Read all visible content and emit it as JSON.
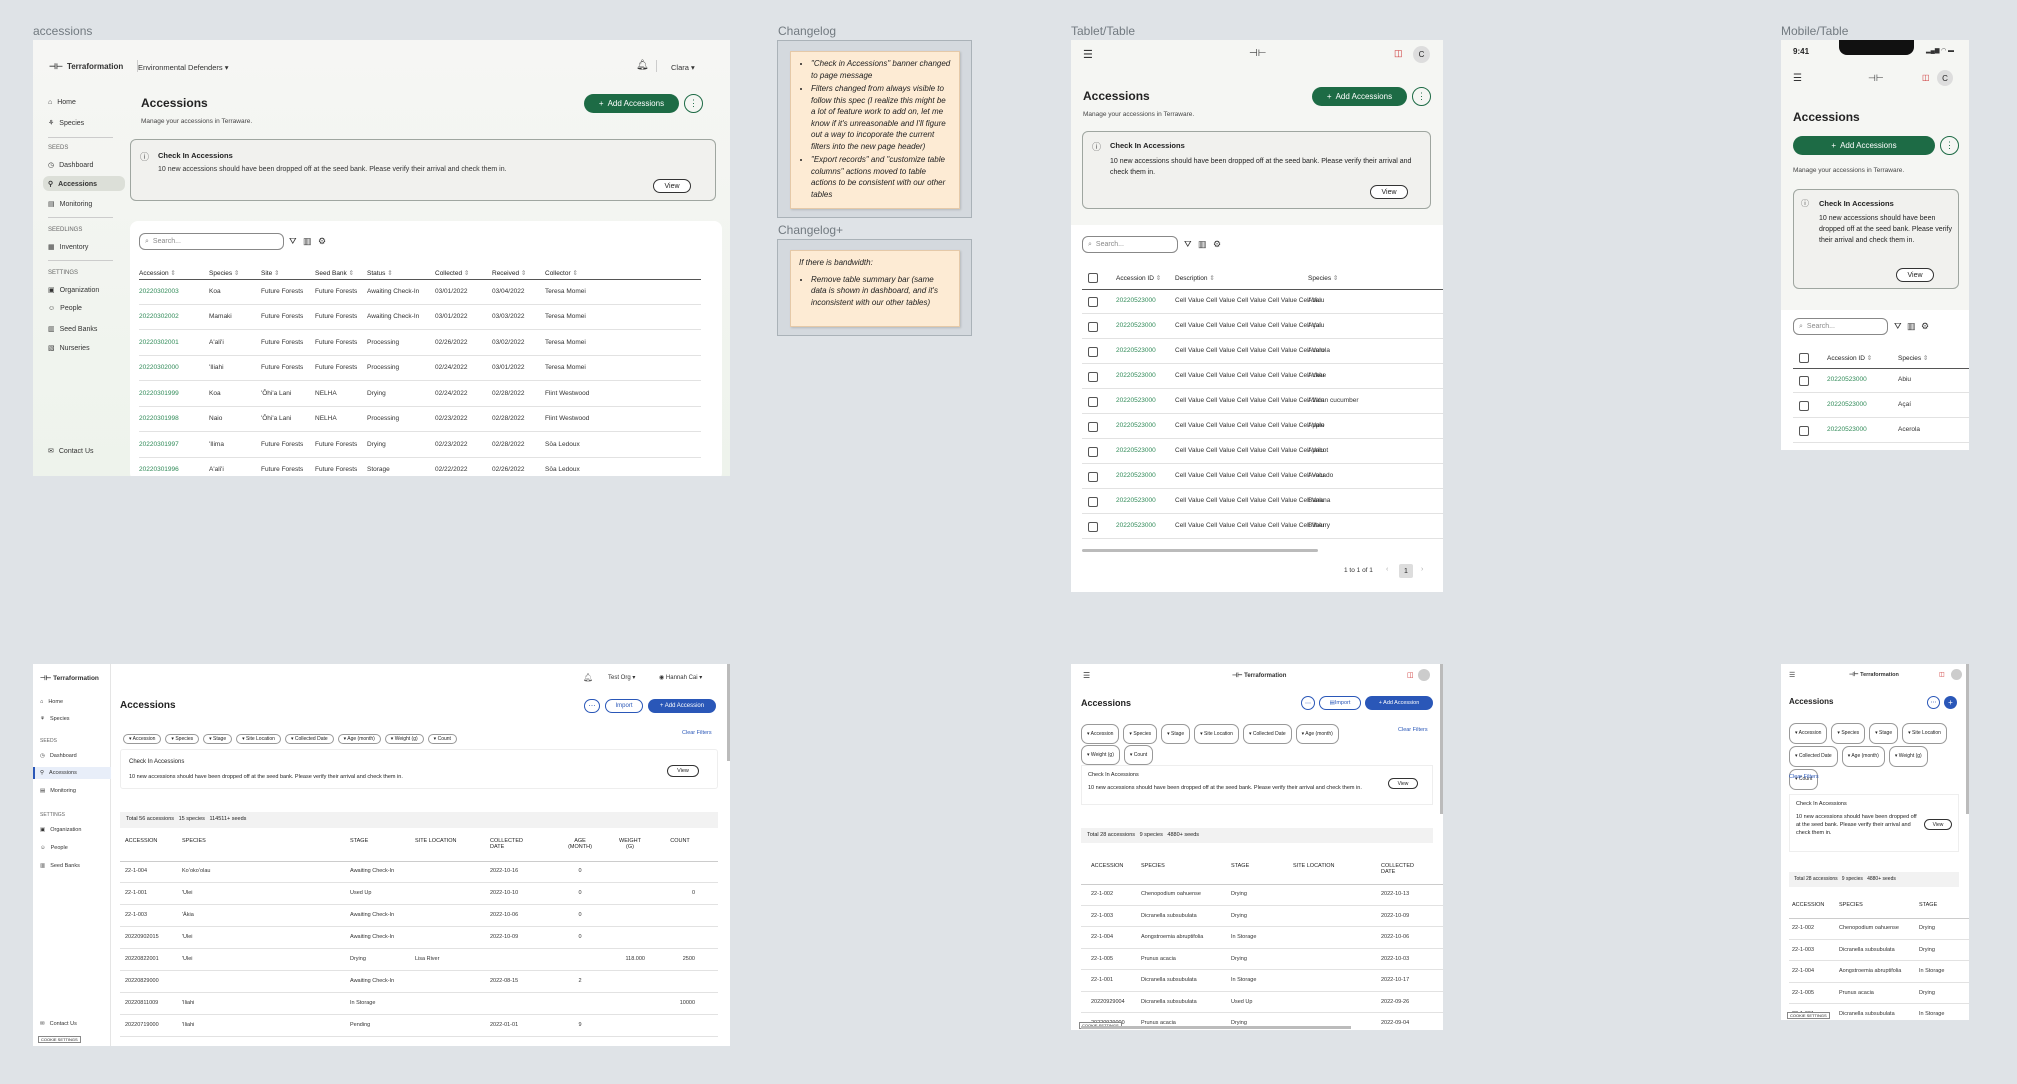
{
  "frame_labels": {
    "accessions": "accessions",
    "changelog": "Changelog",
    "changelog_plus": "Changelog+",
    "tablet": "Tablet/Table",
    "mobile": "Mobile/Table"
  },
  "changelog": {
    "items": [
      "\"Check in Accessions\" banner changed to page message",
      "Filters changed from always visible to follow this spec (I realize this might be a lot of feature work to add on, let me know if it's unreasonable and I'll figure out a way to incoporate the current filters into the new page header)",
      "\"Export records\" and \"customize table columns\" actions moved to table actions to be consistent with our other tables"
    ]
  },
  "changelog_plus": {
    "heading": "If there is bandwidth:",
    "items": [
      "Remove table summary bar (same data is shown in dashboard, and it's inconsistent with our other tables)"
    ]
  },
  "desktop": {
    "logo": "Terraformation",
    "org": "Environmental Defenders",
    "user": "Clara",
    "nav": {
      "home": "Home",
      "species": "Species",
      "seeds_section": "SEEDS",
      "dashboard": "Dashboard",
      "accessions": "Accessions",
      "monitoring": "Monitoring",
      "seedlings_section": "SEEDLINGS",
      "inventory": "Inventory",
      "settings_section": "SETTINGS",
      "organization": "Organization",
      "people": "People",
      "seed_banks": "Seed Banks",
      "nurseries": "Nurseries",
      "contact": "Contact Us"
    },
    "title": "Accessions",
    "subtitle": "Manage your accessions in Terraware.",
    "add_button": "Add Accessions",
    "notice": {
      "title": "Check In Accessions",
      "body": "10 new accessions should have been dropped off at the seed bank. Please verify their arrival and check them in.",
      "view": "View"
    },
    "search_placeholder": "Search...",
    "columns": [
      "Accession",
      "Species",
      "Site",
      "Seed Bank",
      "Status",
      "Collected",
      "Received",
      "Collector"
    ],
    "rows": [
      [
        "20220302003",
        "Koa",
        "Future Forests",
        "Future Forests",
        "Awaiting Check-In",
        "03/01/2022",
        "03/04/2022",
        "Teresa Momei"
      ],
      [
        "20220302002",
        "Mamaki",
        "Future Forests",
        "Future Forests",
        "Awaiting Check-In",
        "03/01/2022",
        "03/03/2022",
        "Teresa Momei"
      ],
      [
        "20220302001",
        "A'ali'i",
        "Future Forests",
        "Future Forests",
        "Processing",
        "02/26/2022",
        "03/02/2022",
        "Teresa Momei"
      ],
      [
        "20220302000",
        "'Iliahi",
        "Future Forests",
        "Future Forests",
        "Processing",
        "02/24/2022",
        "03/01/2022",
        "Teresa Momei"
      ],
      [
        "20220301999",
        "Koa",
        "'Ōhi'a Lani",
        "NELHA",
        "Drying",
        "02/24/2022",
        "02/28/2022",
        "Flint Westwood"
      ],
      [
        "20220301998",
        "Naio",
        "'Ōhi'a Lani",
        "NELHA",
        "Processing",
        "02/23/2022",
        "02/28/2022",
        "Flint Westwood"
      ],
      [
        "20220301997",
        "'Ilima",
        "Future Forests",
        "Future Forests",
        "Drying",
        "02/23/2022",
        "02/28/2022",
        "Sōa Ledoux"
      ],
      [
        "20220301996",
        "A'ali'i",
        "Future Forests",
        "Future Forests",
        "Storage",
        "02/22/2022",
        "02/26/2022",
        "Sōa Ledoux"
      ]
    ]
  },
  "tablet": {
    "title": "Accessions",
    "subtitle": "Manage your accessions in Terraware.",
    "add_button": "Add Accessions",
    "notice": {
      "title": "Check In Accessions",
      "body": "10 new accessions should have been dropped off at the seed bank. Please verify their arrival and check them in.",
      "view": "View"
    },
    "avatar": "C",
    "search_placeholder": "Search...",
    "columns": [
      "Accession ID",
      "Description",
      "Species"
    ],
    "rows": [
      [
        "20220523000",
        "Cell Value Cell Value Cell Value Cell Value Cell Valu",
        "Abiu"
      ],
      [
        "20220523000",
        "Cell Value Cell Value Cell Value Cell Value Cell Valu",
        "Açaí"
      ],
      [
        "20220523000",
        "Cell Value Cell Value Cell Value Cell Value Cell Valu",
        "Acerola"
      ],
      [
        "20220523000",
        "Cell Value Cell Value Cell Value Cell Value Cell Valu",
        "Ackee"
      ],
      [
        "20220523000",
        "Cell Value Cell Value Cell Value Cell Value Cell Valu",
        "African cucumber"
      ],
      [
        "20220523000",
        "Cell Value Cell Value Cell Value Cell Value Cell Valu",
        "Apple"
      ],
      [
        "20220523000",
        "Cell Value Cell Value Cell Value Cell Value Cell Valu",
        "Apricot"
      ],
      [
        "20220523000",
        "Cell Value Cell Value Cell Value Cell Value Cell Valu",
        "Avocado"
      ],
      [
        "20220523000",
        "Cell Value Cell Value Cell Value Cell Value Cell Valu",
        "Banana"
      ],
      [
        "20220523000",
        "Cell Value Cell Value Cell Value Cell Value Cell Valu",
        "Bilberry"
      ]
    ],
    "pagination": "1 to 1 of 1",
    "page": "1"
  },
  "mobile": {
    "time": "9:41",
    "avatar": "C",
    "title": "Accessions",
    "add_button": "Add Accessions",
    "subtitle": "Manage your accessions in Terraware.",
    "notice": {
      "title": "Check In Accessions",
      "body": "10 new accessions should have been dropped off at the seed bank. Please verify their arrival and check them in.",
      "view": "View"
    },
    "search_placeholder": "Search...",
    "columns": [
      "Accession ID",
      "Species"
    ],
    "rows": [
      [
        "20220523000",
        "Abiu"
      ],
      [
        "20220523000",
        "Açaí"
      ],
      [
        "20220523000",
        "Acerola"
      ]
    ]
  },
  "old_desktop": {
    "logo": "Terraformation",
    "org": "Test Org",
    "user": "Hannah Cai",
    "nav": {
      "home": "Home",
      "species": "Species",
      "seeds": "SEEDS",
      "dashboard": "Dashboard",
      "accessions": "Accessions",
      "monitoring": "Monitoring",
      "settings": "SETTINGS",
      "organization": "Organization",
      "people": "People",
      "seed_banks": "Seed Banks",
      "contact": "Contact Us",
      "cookie": "COOKIE SETTINGS"
    },
    "title": "Accessions",
    "import": "Import",
    "add": "+ Add Accession",
    "filters": [
      "Accession",
      "Species",
      "Stage",
      "Site Location",
      "Collected Date",
      "Age (month)",
      "Weight (g)",
      "Count"
    ],
    "clear": "Clear Filters",
    "notice_title": "Check In Accessions",
    "notice_body": "10 new accessions should have been dropped off at the seed bank. Please verify their arrival and check them in.",
    "view": "View",
    "summary": "Total 56 accessions   15 species   114511+ seeds",
    "columns": [
      "ACCESSION",
      "SPECIES",
      "STAGE",
      "SITE LOCATION",
      "COLLECTED DATE",
      "AGE (MONTH)",
      "WEIGHT (G)",
      "COUNT"
    ],
    "rows": [
      [
        "22-1-004",
        "Koʻokoʻolau",
        "Awaiting Check-In",
        "",
        "2022-10-16",
        "0",
        "",
        ""
      ],
      [
        "22-1-001",
        "'Ulei",
        "Used Up",
        "",
        "2022-10-10",
        "0",
        "",
        "0"
      ],
      [
        "22-1-003",
        "'Ākia",
        "Awaiting Check-In",
        "",
        "2022-10-06",
        "0",
        "",
        ""
      ],
      [
        "20220902015",
        "'Ulei",
        "Awaiting Check-In",
        "",
        "2022-10-09",
        "0",
        "",
        ""
      ],
      [
        "20220822001",
        "'Ulei",
        "Drying",
        "Lisa River",
        "",
        "",
        "118.000",
        "2500"
      ],
      [
        "20220829000",
        "",
        "Awaiting Check-In",
        "",
        "2022-08-15",
        "2",
        "",
        ""
      ],
      [
        "20220811009",
        "'Iliahi",
        "In Storage",
        "",
        "",
        "",
        "",
        "10000"
      ],
      [
        "20220719000",
        "'Iliahi",
        "Pending",
        "",
        "2022-01-01",
        "9",
        "",
        ""
      ]
    ]
  },
  "old_tablet": {
    "logo": "Terraformation",
    "title": "Accessions",
    "import": "Import",
    "add": "+ Add Accession",
    "filters": [
      "Accession",
      "Species",
      "Stage",
      "Site Location",
      "Collected Date",
      "Age (month)",
      "Weight (g)",
      "Count"
    ],
    "clear": "Clear Filters",
    "notice_title": "Check In Accessions",
    "notice_body": "10 new accessions should have been dropped off at the seed bank. Please verify their arrival and check them in.",
    "view": "View",
    "summary": "Total 28 accessions   9 species   4880+ seeds",
    "columns": [
      "ACCESSION",
      "SPECIES",
      "STAGE",
      "SITE LOCATION",
      "COLLECTED DATE"
    ],
    "rows": [
      [
        "22-1-002",
        "Chenopodium oahuense",
        "Drying",
        "",
        "2022-10-13"
      ],
      [
        "22-1-003",
        "Dicranella subsubulata",
        "Drying",
        "",
        "2022-10-09"
      ],
      [
        "22-1-004",
        "Aongstroemia abruptifolia",
        "In Storage",
        "",
        "2022-10-06"
      ],
      [
        "22-1-005",
        "Prunus acacia",
        "Drying",
        "",
        "2022-10-03"
      ],
      [
        "22-1-001",
        "Dicranella subsubulata",
        "In Storage",
        "",
        "2022-10-17"
      ],
      [
        "20220929004",
        "Dicranella subsubulata",
        "Used Up",
        "",
        "2022-09-26"
      ],
      [
        "20220929000",
        "Prunus acacia",
        "Drying",
        "",
        "2022-09-04"
      ]
    ],
    "cookie": "COOKIE SETTINGS"
  },
  "old_mobile": {
    "logo": "Terraformation",
    "title": "Accessions",
    "filters": [
      "Accession",
      "Species",
      "Stage",
      "Site Location",
      "Collected Date",
      "Age (month)",
      "Weight (g)",
      "Count"
    ],
    "clear": "Clear Filters",
    "notice_title": "Check In Accessions",
    "notice_body": "10 new accessions should have been dropped off at the seed bank. Please verify their arrival and check them in.",
    "view": "View",
    "summary": "Total 28 accessions   9 species   4880+ seeds",
    "columns": [
      "ACCESSION",
      "SPECIES",
      "STAGE"
    ],
    "rows": [
      [
        "22-1-002",
        "Chenopodium oahuense",
        "Drying"
      ],
      [
        "22-1-003",
        "Dicranella subsubulata",
        "Drying"
      ],
      [
        "22-1-004",
        "Aongstroemia abruptifolia",
        "In Storage"
      ],
      [
        "22-1-005",
        "Prunus acacia",
        "Drying"
      ],
      [
        "22-1-001",
        "Dicranella subsubulata",
        "In Storage"
      ]
    ],
    "cookie": "COOKIE SETTINGS"
  }
}
